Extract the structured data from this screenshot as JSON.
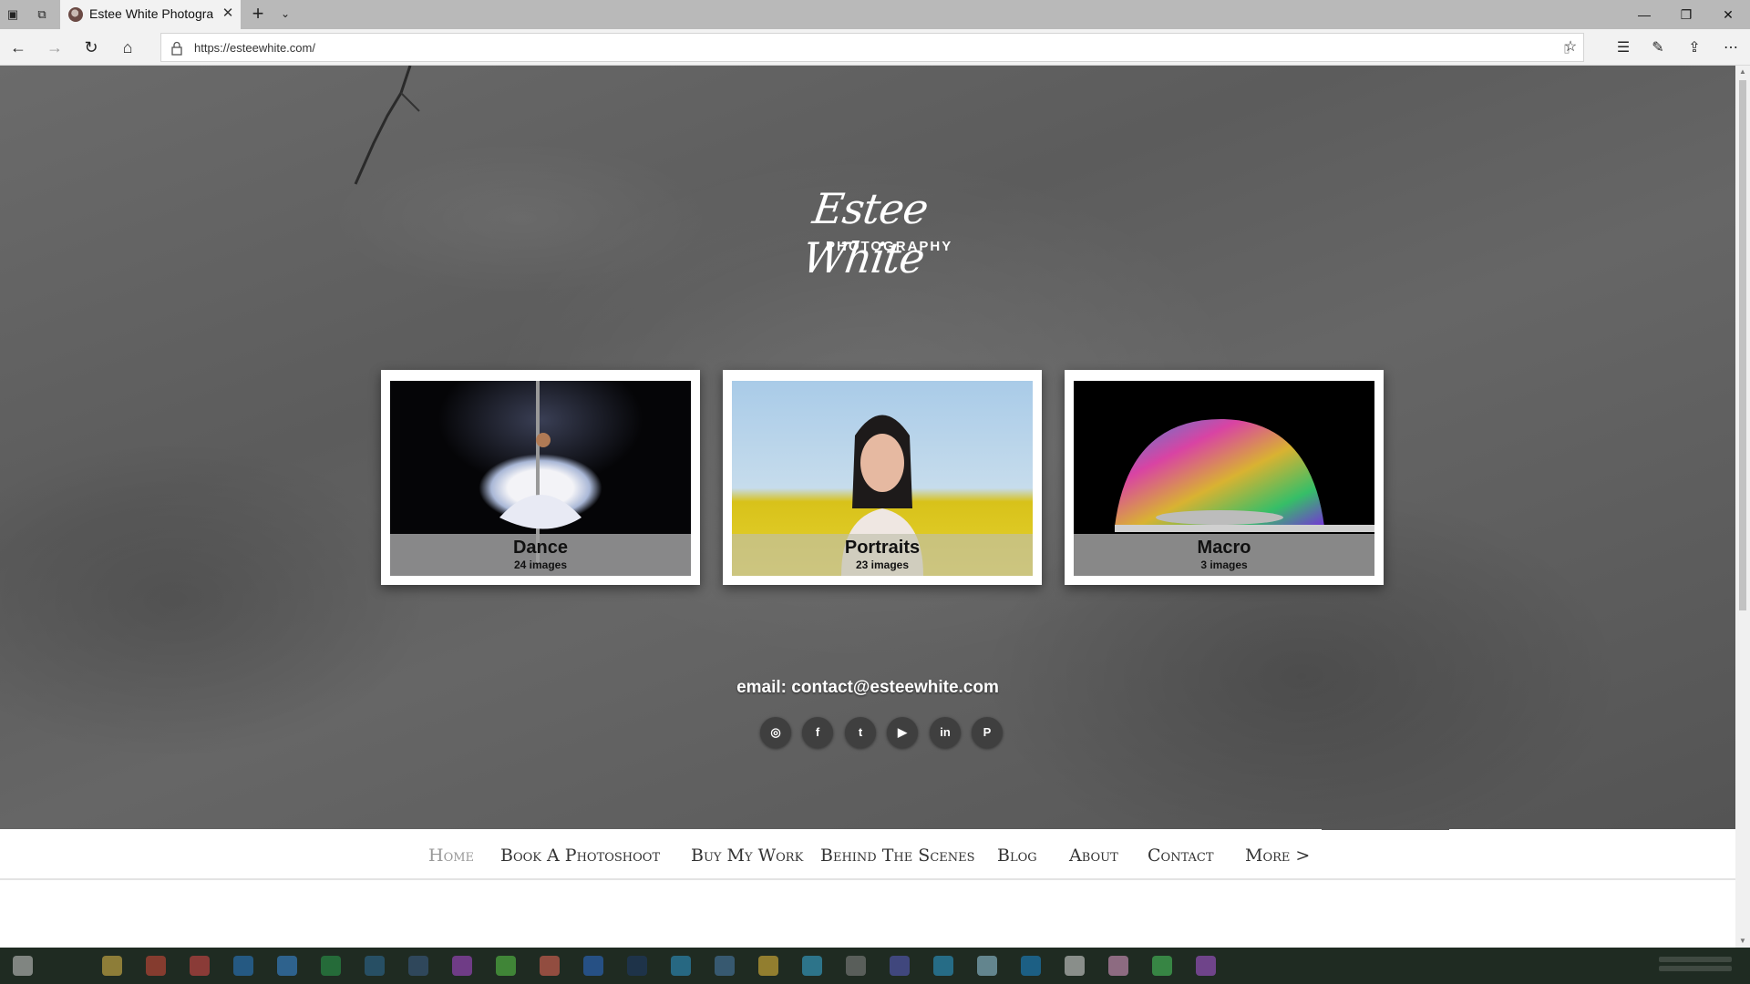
{
  "browser": {
    "tab_title": "Estee White Photograph",
    "url": "https://esteewhite.com/",
    "icons": {
      "tab_actions": "tab-actions-icon",
      "tab_aside": "tabs-aside-icon",
      "close_tab": "close-icon",
      "new_tab": "plus-icon",
      "tab_list": "chevron-down-icon",
      "back": "back-arrow-icon",
      "forward": "forward-arrow-icon",
      "refresh": "refresh-icon",
      "home": "home-icon",
      "lock": "lock-icon",
      "reading_view": "reading-view-icon",
      "favorite": "star-icon",
      "favorites_hub": "favorites-hub-icon",
      "notes": "pen-icon",
      "share": "share-icon",
      "more": "more-icon",
      "minimize": "minimize-icon",
      "maximize": "restore-icon",
      "close_window": "close-icon"
    }
  },
  "site": {
    "logo_script": "Estee White",
    "logo_sub": "PHOTOGRAPHY",
    "galleries": [
      {
        "name": "Dance",
        "count": "24 images"
      },
      {
        "name": "Portraits",
        "count": "23 images"
      },
      {
        "name": "Macro",
        "count": "3 images"
      }
    ],
    "email": "email: contact@esteewhite.com",
    "socials": [
      {
        "name": "instagram-icon",
        "glyph": "◎"
      },
      {
        "name": "facebook-icon",
        "glyph": "f"
      },
      {
        "name": "twitter-icon",
        "glyph": "t"
      },
      {
        "name": "youtube-icon",
        "glyph": "▶"
      },
      {
        "name": "linkedin-icon",
        "glyph": "in"
      },
      {
        "name": "pinterest-icon",
        "glyph": "P"
      }
    ],
    "menu": [
      {
        "label": "Home",
        "active": true
      },
      {
        "label": "Book A Photoshoot"
      },
      {
        "label": "Buy My Work"
      },
      {
        "label": "Behind The Scenes"
      },
      {
        "label": "Blog"
      },
      {
        "label": "About"
      },
      {
        "label": "Contact"
      },
      {
        "label": "More >"
      }
    ]
  },
  "colors": {
    "hero_stone": "#5f5f5f",
    "caption_bg": "#a0a0a0",
    "menu_active": "#999999",
    "menu_text": "#333333",
    "taskbar": "#1f2b22"
  }
}
